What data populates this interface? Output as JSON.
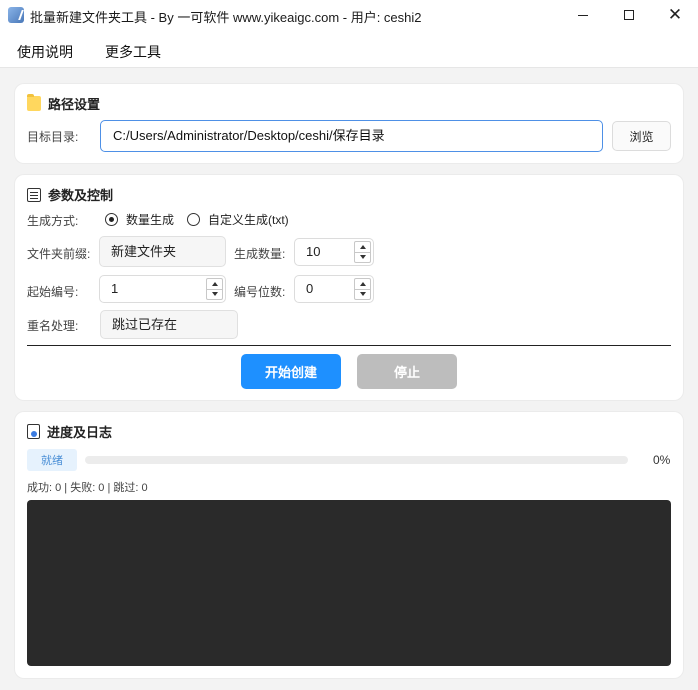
{
  "window": {
    "title": "批量新建文件夹工具 - By 一可软件 www.yikeaigc.com - 用户: ceshi2"
  },
  "menu": {
    "items": [
      {
        "label": "使用说明"
      },
      {
        "label": "更多工具"
      }
    ]
  },
  "path_section": {
    "title": "路径设置",
    "target_label": "目标目录:",
    "target_value": "C:/Users/Administrator/Desktop/ceshi/保存目录",
    "browse_label": "浏览"
  },
  "params_section": {
    "title": "参数及控制",
    "mode_label": "生成方式:",
    "mode_options": [
      {
        "label": "数量生成",
        "selected": true
      },
      {
        "label": "自定义生成(txt)",
        "selected": false
      }
    ],
    "prefix_label": "文件夹前缀:",
    "prefix_value": "新建文件夹",
    "count_label": "生成数量:",
    "count_value": "10",
    "start_label": "起始编号:",
    "start_value": "1",
    "digits_label": "编号位数:",
    "digits_value": "0",
    "rename_label": "重名处理:",
    "rename_value": "跳过已存在",
    "start_button": "开始创建",
    "stop_button": "停止"
  },
  "log_section": {
    "title": "进度及日志",
    "status": "就绪",
    "progress_percent": 0,
    "progress_text": "0%",
    "counts_text": "成功: 0  |  失败: 0  |  跳过: 0",
    "log_text": ""
  },
  "colors": {
    "accent": "#1e90ff",
    "disabled": "#bdbdbd",
    "log_bg": "#2a2a2a",
    "badge_bg": "#e6f2fd",
    "badge_text": "#4a8fd6"
  }
}
